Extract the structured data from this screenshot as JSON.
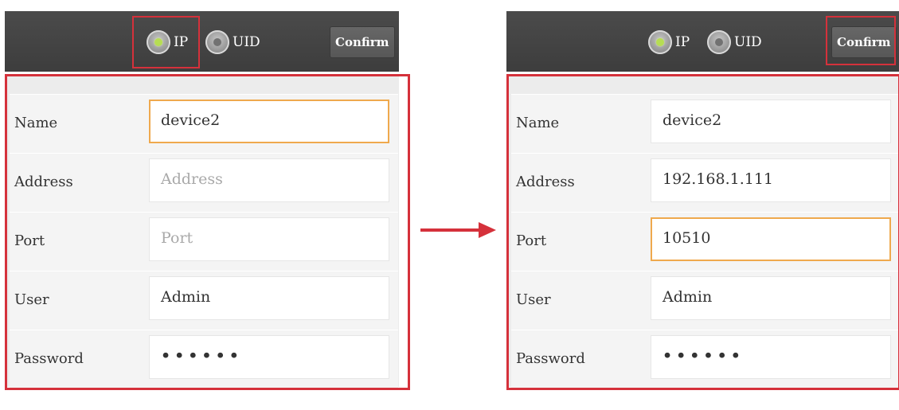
{
  "labels": {
    "ip": "IP",
    "uid": "UID",
    "confirm": "Confirm",
    "name": "Name",
    "address": "Address",
    "port": "Port",
    "user": "User",
    "password": "Password"
  },
  "before": {
    "mode": "IP",
    "name_value": "device2",
    "address_placeholder": "Address",
    "port_placeholder": "Port",
    "user_value": "Admin",
    "password_mask": "••••••",
    "focused_field": "Name"
  },
  "after": {
    "mode": "IP",
    "name_value": "device2",
    "address_value": "192.168.1.111",
    "port_value": "10510",
    "user_value": "Admin",
    "password_mask": "••••••",
    "focused_field": "Port"
  },
  "colors": {
    "highlight": "#d5313b",
    "focus_border": "#efa94d",
    "radio_on": "#b6dd53",
    "toolbar": "#444444"
  },
  "icons": {
    "radio_on": "radio-selected-icon",
    "radio_off": "radio-unselected-icon",
    "arrow": "right-arrow-icon"
  }
}
